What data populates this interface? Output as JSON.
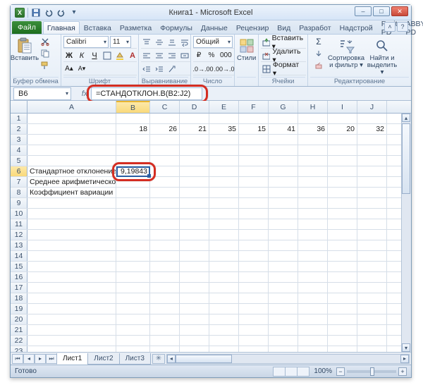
{
  "title": "Книга1 - Microsoft Excel",
  "tabs": {
    "file": "Файл",
    "items": [
      "Главная",
      "Вставка",
      "Разметка",
      "Формулы",
      "Данные",
      "Рецензир",
      "Вид",
      "Разработ",
      "Надстрой",
      "Foxit PD",
      "ABBYY PD"
    ],
    "active": 0
  },
  "ribbon": {
    "clipboard": {
      "paste": "Вставить",
      "label": "Буфер обмена"
    },
    "font": {
      "name": "Calibri",
      "size": "11",
      "label": "Шрифт"
    },
    "align": {
      "label": "Выравнивание"
    },
    "number": {
      "format": "Общий",
      "label": "Число"
    },
    "styles": {
      "styles": "Стили",
      "label": ""
    },
    "cells": {
      "insert": "Вставить ▾",
      "delete": "Удалить ▾",
      "format": "Формат ▾",
      "label": "Ячейки"
    },
    "editing": {
      "sort": "Сортировка",
      "sort2": "и фильтр ▾",
      "find": "Найти и",
      "find2": "выделить ▾",
      "label": "Редактирование"
    }
  },
  "namebox": "B6",
  "formula": "=СТАНДОТКЛОН.В(B2:J2)",
  "columns": [
    "A",
    "B",
    "C",
    "D",
    "E",
    "F",
    "G",
    "H",
    "I",
    "J"
  ],
  "grid": {
    "row2": [
      "",
      "18",
      "26",
      "21",
      "35",
      "15",
      "41",
      "36",
      "20",
      "32"
    ],
    "row6": [
      "Стандартное отклонение",
      "9,19843",
      "",
      "",
      "",
      "",
      "",
      "",
      "",
      ""
    ],
    "row7": [
      "Среднее арифметическое",
      "",
      "",
      "",
      "",
      "",
      "",
      "",
      "",
      ""
    ],
    "row8": [
      "Коэффициент вариации",
      "",
      "",
      "",
      "",
      "",
      "",
      "",
      "",
      ""
    ]
  },
  "sheets": [
    "Лист1",
    "Лист2",
    "Лист3"
  ],
  "status": {
    "ready": "Готово",
    "zoom": "100%"
  },
  "win": {
    "min": "–",
    "max": "□",
    "close": "✕"
  },
  "chart_data": null
}
